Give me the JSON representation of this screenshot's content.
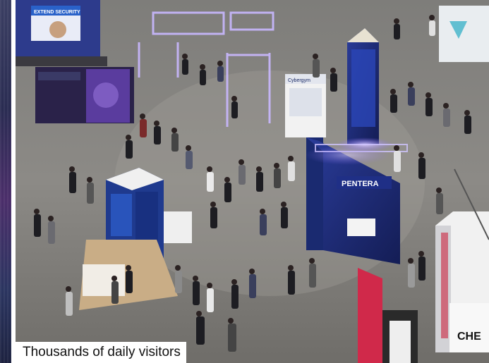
{
  "caption": "Thousands of daily visitors",
  "booth_signs": {
    "extend": "EXTEND SECURITY",
    "cyber": "Cybergym",
    "pentera": "PENTERA",
    "che": "CHE"
  },
  "colors": {
    "floor": "#8c8a86",
    "booth_blue": "#1e2d78",
    "booth_purple": "#3a1f6e",
    "light_glow": "#c9b8ff",
    "caption_bg": "#ffffff"
  }
}
